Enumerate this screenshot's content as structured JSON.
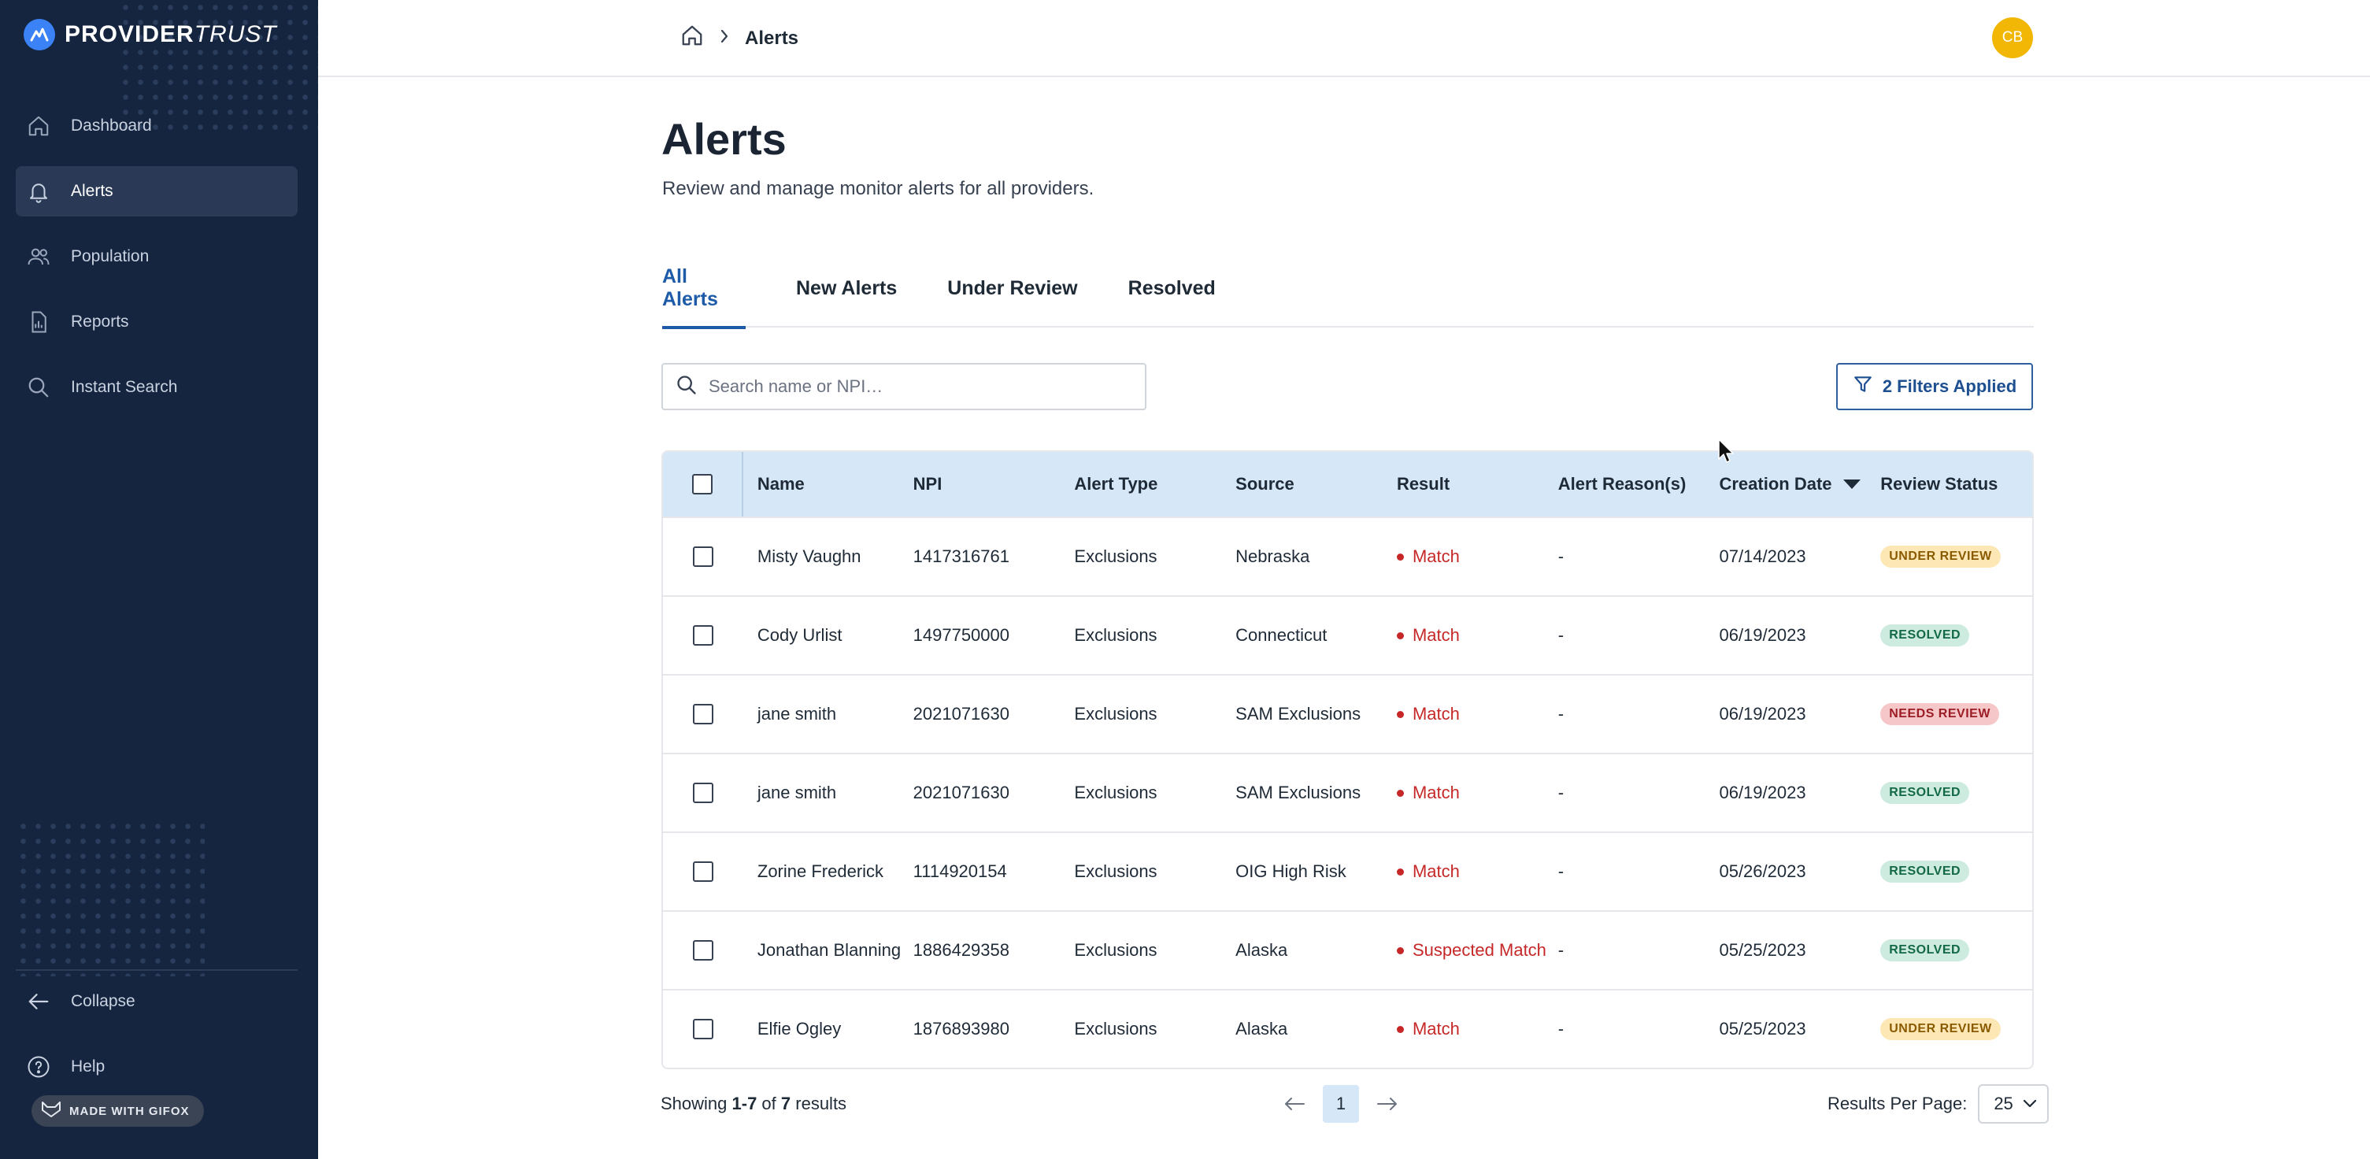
{
  "brand": {
    "name_bold": "PROVIDER",
    "name_italic": "TRUST"
  },
  "sidebar": {
    "items": [
      {
        "label": "Dashboard",
        "icon": "home-icon"
      },
      {
        "label": "Alerts",
        "icon": "bell-icon",
        "active": true
      },
      {
        "label": "Population",
        "icon": "users-icon"
      },
      {
        "label": "Reports",
        "icon": "report-icon"
      },
      {
        "label": "Instant Search",
        "icon": "search-icon"
      }
    ],
    "collapse_label": "Collapse",
    "help_label": "Help",
    "gifox_label": "MADE WITH GIFOX"
  },
  "header": {
    "breadcrumb_current": "Alerts",
    "avatar_initials": "CB"
  },
  "page": {
    "title": "Alerts",
    "subtitle": "Review and manage monitor alerts for all providers."
  },
  "tabs": [
    {
      "label": "All Alerts",
      "active": true
    },
    {
      "label": "New Alerts"
    },
    {
      "label": "Under Review"
    },
    {
      "label": "Resolved"
    }
  ],
  "search": {
    "placeholder": "Search name or NPI…"
  },
  "filters": {
    "label": "2 Filters Applied"
  },
  "table": {
    "columns": [
      "Name",
      "NPI",
      "Alert Type",
      "Source",
      "Result",
      "Alert Reason(s)",
      "Creation Date",
      "Review Status"
    ],
    "sort_column": "Creation Date",
    "rows": [
      {
        "name": "Misty Vaughn",
        "npi": "1417316761",
        "type": "Exclusions",
        "source": "Nebraska",
        "result": "Match",
        "reason": "-",
        "date": "07/14/2023",
        "status": "UNDER REVIEW",
        "status_kind": "under"
      },
      {
        "name": "Cody Urlist",
        "npi": "1497750000",
        "type": "Exclusions",
        "source": "Connecticut",
        "result": "Match",
        "reason": "-",
        "date": "06/19/2023",
        "status": "RESOLVED",
        "status_kind": "resolved"
      },
      {
        "name": "jane smith",
        "npi": "2021071630",
        "type": "Exclusions",
        "source": "SAM Exclusions",
        "result": "Match",
        "reason": "-",
        "date": "06/19/2023",
        "status": "NEEDS REVIEW",
        "status_kind": "needs"
      },
      {
        "name": "jane smith",
        "npi": "2021071630",
        "type": "Exclusions",
        "source": "SAM Exclusions",
        "result": "Match",
        "reason": "-",
        "date": "06/19/2023",
        "status": "RESOLVED",
        "status_kind": "resolved"
      },
      {
        "name": "Zorine Frederick",
        "npi": "1114920154",
        "type": "Exclusions",
        "source": "OIG High Risk",
        "result": "Match",
        "reason": "-",
        "date": "05/26/2023",
        "status": "RESOLVED",
        "status_kind": "resolved"
      },
      {
        "name": "Jonathan Blanning",
        "npi": "1886429358",
        "type": "Exclusions",
        "source": "Alaska",
        "result": "Suspected Match",
        "reason": "-",
        "date": "05/25/2023",
        "status": "RESOLVED",
        "status_kind": "resolved"
      },
      {
        "name": "Elfie Ogley",
        "npi": "1876893980",
        "type": "Exclusions",
        "source": "Alaska",
        "result": "Match",
        "reason": "-",
        "date": "05/25/2023",
        "status": "UNDER REVIEW",
        "status_kind": "under"
      }
    ]
  },
  "footer": {
    "showing_prefix": "Showing ",
    "showing_range": "1-7",
    "showing_of": " of ",
    "showing_total": "7",
    "showing_suffix": " results",
    "current_page": "1",
    "rpp_label": "Results Per Page:",
    "rpp_value": "25"
  },
  "colors": {
    "sidebar_bg": "#15243f",
    "accent": "#1d5aa8",
    "header_row": "#d6e7f8",
    "match_red": "#c62828",
    "avatar": "#f2b705"
  }
}
